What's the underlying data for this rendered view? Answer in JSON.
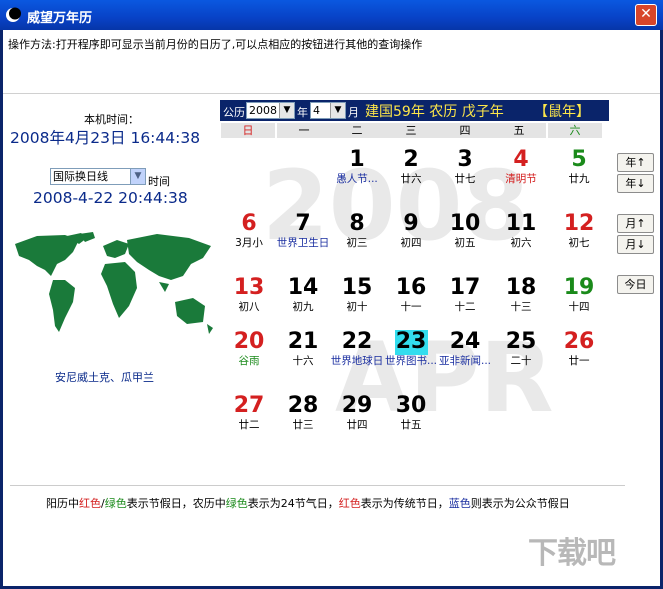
{
  "window": {
    "title": "威望万年历",
    "close_symbol": "✕"
  },
  "instructions": "操作方法:打开程序即可显示当前月份的日历了,可以点相应的按钮进行其他的查询操作",
  "local_time_label": "本机时间：",
  "local_time": "2008年4月23日   16:44:38",
  "timezone_select": "国际换日线",
  "timezone_time_label": "时间",
  "timezone_time": "2008-4-22 20:44:38",
  "city": "安尼威土克、瓜甲兰",
  "header": {
    "gongli_label": "公历",
    "year_value": "2008",
    "year_label": "年",
    "month_value": "4",
    "month_label": "月",
    "lunar_text": "建国59年  农历  戊子年",
    "zodiac": "【鼠年】"
  },
  "weekdays": [
    "日",
    "一",
    "二",
    "三",
    "四",
    "五",
    "六"
  ],
  "watermark": {
    "year": "2008",
    "month": "APR"
  },
  "days": [
    {
      "num": "1",
      "sub": "愚人节...",
      "color": "#000",
      "sub_color": "#1a2ea0"
    },
    {
      "num": "2",
      "sub": "廿六",
      "color": "#000",
      "sub_color": "#000"
    },
    {
      "num": "3",
      "sub": "廿七",
      "color": "#000",
      "sub_color": "#000"
    },
    {
      "num": "4",
      "sub": "清明节",
      "color": "#d42020",
      "sub_color": "#d42020"
    },
    {
      "num": "5",
      "sub": "廿九",
      "color": "#1a8a1a",
      "sub_color": "#000"
    },
    {
      "num": "6",
      "sub": "3月小",
      "color": "#d42020",
      "sub_color": "#000"
    },
    {
      "num": "7",
      "sub": "世界卫生日",
      "color": "#000",
      "sub_color": "#1a2ea0"
    },
    {
      "num": "8",
      "sub": "初三",
      "color": "#000",
      "sub_color": "#000"
    },
    {
      "num": "9",
      "sub": "初四",
      "color": "#000",
      "sub_color": "#000"
    },
    {
      "num": "10",
      "sub": "初五",
      "color": "#000",
      "sub_color": "#000"
    },
    {
      "num": "11",
      "sub": "初六",
      "color": "#000",
      "sub_color": "#000"
    },
    {
      "num": "12",
      "sub": "初七",
      "color": "#d42020",
      "sub_color": "#000"
    },
    {
      "num": "13",
      "sub": "初八",
      "color": "#d42020",
      "sub_color": "#000"
    },
    {
      "num": "14",
      "sub": "初九",
      "color": "#000",
      "sub_color": "#000"
    },
    {
      "num": "15",
      "sub": "初十",
      "color": "#000",
      "sub_color": "#000"
    },
    {
      "num": "16",
      "sub": "十一",
      "color": "#000",
      "sub_color": "#000"
    },
    {
      "num": "17",
      "sub": "十二",
      "color": "#000",
      "sub_color": "#000"
    },
    {
      "num": "18",
      "sub": "十三",
      "color": "#000",
      "sub_color": "#000"
    },
    {
      "num": "19",
      "sub": "十四",
      "color": "#1a8a1a",
      "sub_color": "#000"
    },
    {
      "num": "20",
      "sub": "谷雨",
      "color": "#d42020",
      "sub_color": "#1a8a1a"
    },
    {
      "num": "21",
      "sub": "十六",
      "color": "#000",
      "sub_color": "#000"
    },
    {
      "num": "22",
      "sub": "世界地球日",
      "color": "#000",
      "sub_color": "#1a2ea0"
    },
    {
      "num": "23",
      "sub": "世界图书...",
      "color": "#000",
      "sub_color": "#1a2ea0",
      "today": true
    },
    {
      "num": "24",
      "sub": "亚非新闻...",
      "color": "#000",
      "sub_color": "#1a2ea0"
    },
    {
      "num": "25",
      "sub": "二十",
      "color": "#000",
      "sub_color": "#000"
    },
    {
      "num": "26",
      "sub": "廿一",
      "color": "#d42020",
      "sub_color": "#000"
    },
    {
      "num": "27",
      "sub": "廿二",
      "color": "#d42020",
      "sub_color": "#000"
    },
    {
      "num": "28",
      "sub": "廿三",
      "color": "#000",
      "sub_color": "#000"
    },
    {
      "num": "29",
      "sub": "廿四",
      "color": "#000",
      "sub_color": "#000"
    },
    {
      "num": "30",
      "sub": "廿五",
      "color": "#000",
      "sub_color": "#000"
    }
  ],
  "buttons": {
    "year_up": "年↑",
    "year_down": "年↓",
    "month_up": "月↑",
    "month_down": "月↓",
    "today": "今日"
  },
  "legend": [
    {
      "text": "阳历中",
      "color": "#000"
    },
    {
      "text": "红色",
      "color": "#d42020"
    },
    {
      "text": "/",
      "color": "#000"
    },
    {
      "text": "绿色",
      "color": "#1a8a1a"
    },
    {
      "text": "表示节假日，农历中",
      "color": "#000"
    },
    {
      "text": "绿色",
      "color": "#1a8a1a"
    },
    {
      "text": "表示为24节气日，",
      "color": "#000"
    },
    {
      "text": "红色",
      "color": "#d42020"
    },
    {
      "text": "表示为传统节日，",
      "color": "#000"
    },
    {
      "text": "蓝色",
      "color": "#1a2ea0"
    },
    {
      "text": "则表示为公众节假日",
      "color": "#000"
    }
  ],
  "site_logo": "下载吧",
  "colors": {
    "title_bar": "#0a4ad6",
    "today_highlight": "#33ddee",
    "header_bg": "#0a246a",
    "lunar_text": "#fde64a"
  }
}
